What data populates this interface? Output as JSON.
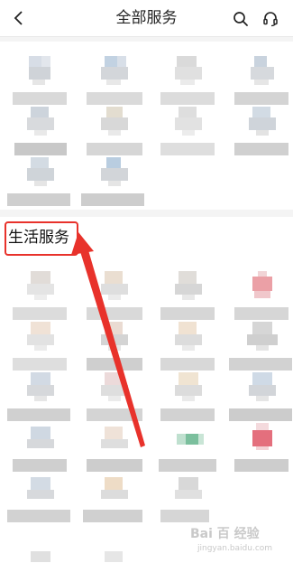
{
  "header": {
    "title": "全部服务",
    "back_icon": "chevron-left-icon",
    "search_icon": "search-icon",
    "support_icon": "headset-icon"
  },
  "section_life": {
    "title": "生活服务"
  },
  "annotation": {
    "color": "#e8322b"
  },
  "watermark": {
    "logo": "Bai 百 经验",
    "url": "jingyan.baidu.com"
  }
}
